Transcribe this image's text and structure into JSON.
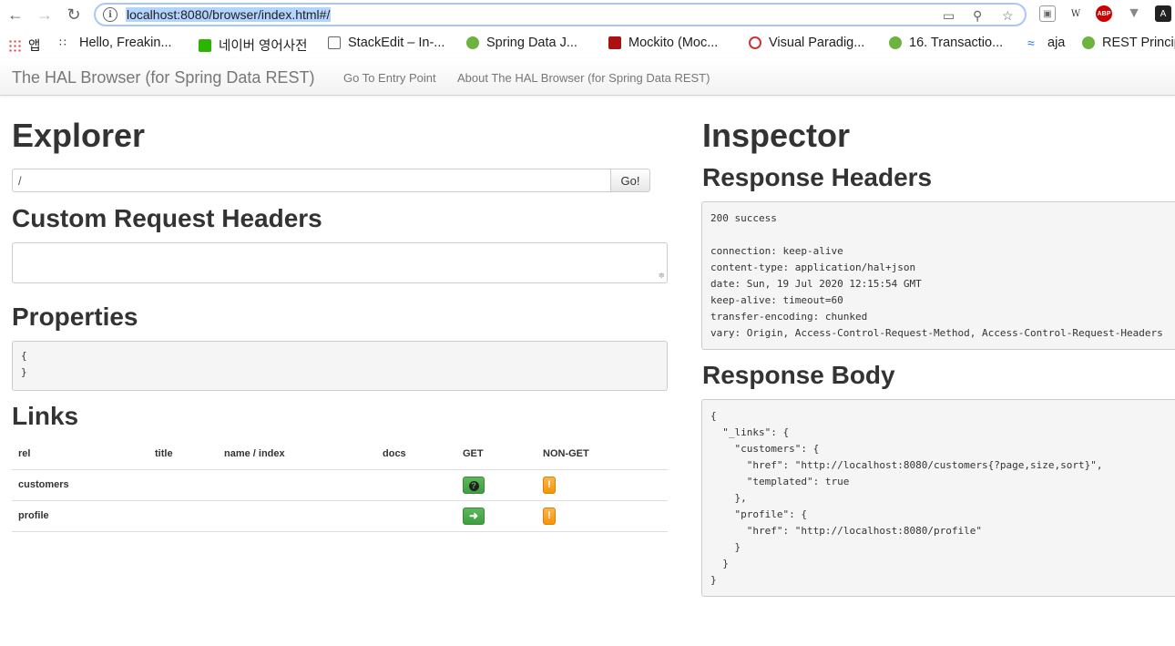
{
  "browser": {
    "url": "localhost:8080/browser/index.html#/",
    "bookmarks": [
      "앱",
      "Hello, Freakin...",
      "네이버 영어사전",
      "StackEdit – In-...",
      "Spring Data J...",
      "Mockito (Moc...",
      "Visual Paradig...",
      "16. Transactio...",
      "aja",
      "REST Princip"
    ],
    "extensions": [
      "W",
      "ABP"
    ]
  },
  "halnav": {
    "brand": "The HAL Browser (for Spring Data REST)",
    "links": [
      "Go To Entry Point",
      "About The HAL Browser (for Spring Data REST)"
    ]
  },
  "explorer": {
    "title": "Explorer",
    "url_value": "/",
    "go_label": "Go!",
    "custom_headers_title": "Custom Request Headers",
    "properties_title": "Properties",
    "properties_body": "{\n}",
    "links_title": "Links",
    "links_headers": [
      "rel",
      "title",
      "name / index",
      "docs",
      "GET",
      "NON-GET"
    ],
    "links_rows": [
      {
        "rel": "customers",
        "get_icon": "question-icon",
        "nonget_icon": "exclamation-icon"
      },
      {
        "rel": "profile",
        "get_icon": "arrow-right-icon",
        "nonget_icon": "exclamation-icon"
      }
    ]
  },
  "inspector": {
    "title": "Inspector",
    "response_headers_title": "Response Headers",
    "response_headers_body": "200 success\n\nconnection: keep-alive\ncontent-type: application/hal+json\ndate: Sun, 19 Jul 2020 12:15:54 GMT\nkeep-alive: timeout=60\ntransfer-encoding: chunked\nvary: Origin, Access-Control-Request-Method, Access-Control-Request-Headers",
    "response_body_title": "Response Body",
    "response_body": "{\n  \"_links\": {\n    \"customers\": {\n      \"href\": \"http://localhost:8080/customers{?page,size,sort}\",\n      \"templated\": true\n    },\n    \"profile\": {\n      \"href\": \"http://localhost:8080/profile\"\n    }\n  }\n}"
  }
}
